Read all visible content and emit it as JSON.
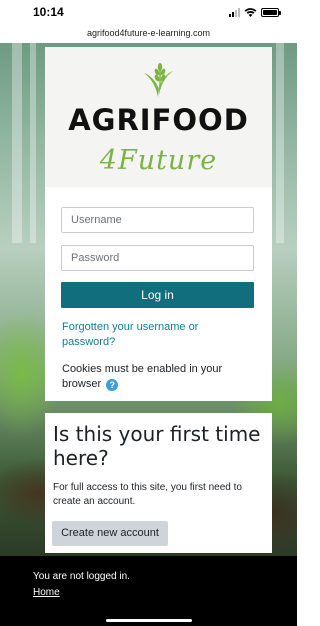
{
  "status_bar": {
    "time": "10:14"
  },
  "browser": {
    "url": "agrifood4future-e-learning.com"
  },
  "logo": {
    "title": "AGRIFOOD",
    "subtitle": "4Future",
    "brand_color": "#7cb342"
  },
  "login": {
    "username_placeholder": "Username",
    "password_placeholder": "Password",
    "login_label": "Log in",
    "forgot_link": "Forgotten your username or password?",
    "cookies_text": "Cookies must be enabled in your browser",
    "help_icon": "?",
    "accent_color": "#106e7d"
  },
  "signup": {
    "heading": "Is this your first time here?",
    "text": "For full access to this site, you first need to create an account.",
    "button_label": "Create new account"
  },
  "footer": {
    "status": "You are not logged in.",
    "home_link": "Home"
  }
}
